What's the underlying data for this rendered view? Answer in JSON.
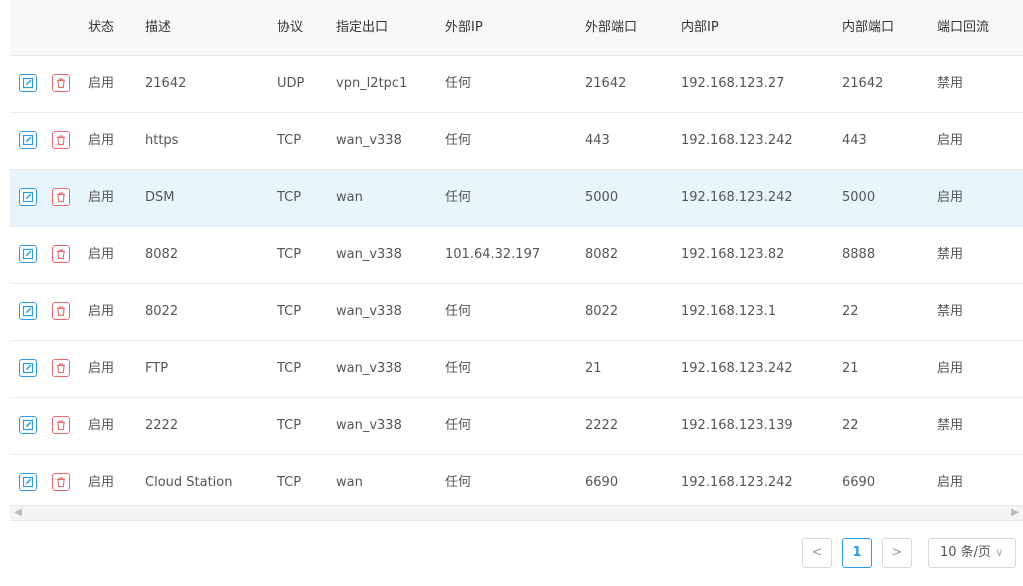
{
  "columns": {
    "status": "状态",
    "description": "描述",
    "protocol": "协议",
    "interface": "指定出口",
    "external_ip": "外部IP",
    "external_port": "外部端口",
    "internal_ip": "内部IP",
    "internal_port": "内部端口",
    "loopback": "端口回流"
  },
  "rows": [
    {
      "status": "启用",
      "description": "21642",
      "protocol": "UDP",
      "interface": "vpn_l2tpc1",
      "external_ip": "任何",
      "external_port": "21642",
      "internal_ip": "192.168.123.27",
      "internal_port": "21642",
      "loopback": "禁用"
    },
    {
      "status": "启用",
      "description": "https",
      "protocol": "TCP",
      "interface": "wan_v338",
      "external_ip": "任何",
      "external_port": "443",
      "internal_ip": "192.168.123.242",
      "internal_port": "443",
      "loopback": "启用"
    },
    {
      "status": "启用",
      "description": "DSM",
      "protocol": "TCP",
      "interface": "wan",
      "external_ip": "任何",
      "external_port": "5000",
      "internal_ip": "192.168.123.242",
      "internal_port": "5000",
      "loopback": "启用"
    },
    {
      "status": "启用",
      "description": "8082",
      "protocol": "TCP",
      "interface": "wan_v338",
      "external_ip": "101.64.32.197",
      "external_port": "8082",
      "internal_ip": "192.168.123.82",
      "internal_port": "8888",
      "loopback": "禁用"
    },
    {
      "status": "启用",
      "description": "8022",
      "protocol": "TCP",
      "interface": "wan_v338",
      "external_ip": "任何",
      "external_port": "8022",
      "internal_ip": "192.168.123.1",
      "internal_port": "22",
      "loopback": "禁用"
    },
    {
      "status": "启用",
      "description": "FTP",
      "protocol": "TCP",
      "interface": "wan_v338",
      "external_ip": "任何",
      "external_port": "21",
      "internal_ip": "192.168.123.242",
      "internal_port": "21",
      "loopback": "启用"
    },
    {
      "status": "启用",
      "description": "2222",
      "protocol": "TCP",
      "interface": "wan_v338",
      "external_ip": "任何",
      "external_port": "2222",
      "internal_ip": "192.168.123.139",
      "internal_port": "22",
      "loopback": "禁用"
    },
    {
      "status": "启用",
      "description": "Cloud Station",
      "protocol": "TCP",
      "interface": "wan",
      "external_ip": "任何",
      "external_port": "6690",
      "internal_ip": "192.168.123.242",
      "internal_port": "6690",
      "loopback": "启用"
    }
  ],
  "highlighted_row": 2,
  "icons": {
    "edit": "edit-icon",
    "delete": "trash-icon"
  },
  "colors": {
    "accent": "#2d9ae8",
    "danger": "#f0686a",
    "highlight": "#e8f5fd"
  },
  "pagination": {
    "prev": "<",
    "current_page": "1",
    "next": ">",
    "page_size": "10 条/页"
  }
}
